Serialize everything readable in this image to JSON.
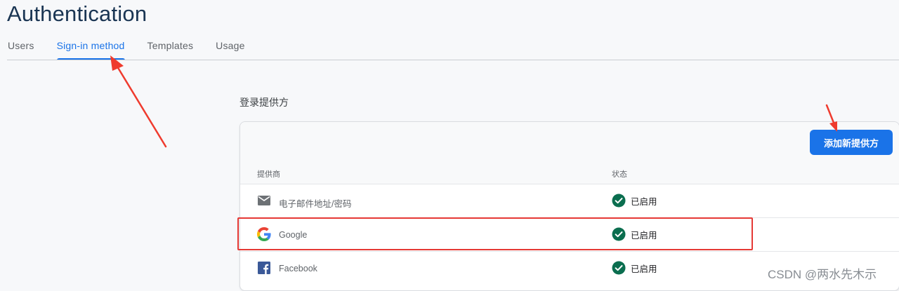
{
  "header": {
    "title": "Authentication"
  },
  "tabs": [
    {
      "label": "Users",
      "active": false
    },
    {
      "label": "Sign-in method",
      "active": true
    },
    {
      "label": "Templates",
      "active": false
    },
    {
      "label": "Usage",
      "active": false
    }
  ],
  "section": {
    "title": "登录提供方"
  },
  "card": {
    "add_button_label": "添加新提供方",
    "columns": {
      "provider": "提供商",
      "status": "状态"
    },
    "providers": [
      {
        "name": "电子邮件地址/密码",
        "icon": "email-icon",
        "status": "已启用"
      },
      {
        "name": "Google",
        "icon": "google-icon",
        "status": "已启用"
      },
      {
        "name": "Facebook",
        "icon": "facebook-icon",
        "status": "已启用"
      }
    ]
  },
  "watermark": "CSDN @两水先木示",
  "colors": {
    "accent": "#1a73e8",
    "title": "#1a3553",
    "status_enabled": "#0b6e4f",
    "annotation": "#e53935"
  }
}
